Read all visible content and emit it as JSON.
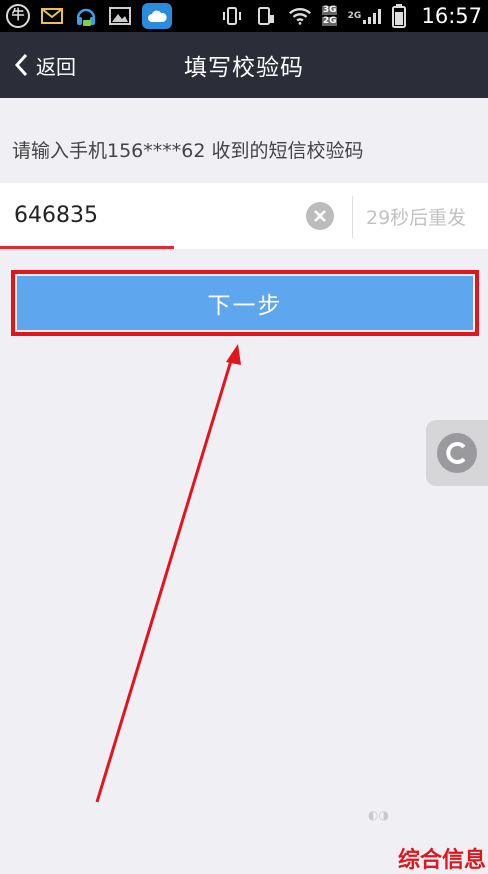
{
  "status_bar": {
    "carrier_glyph": "牛",
    "network_tags": [
      "3G",
      "2G",
      "2G"
    ],
    "time": "16:57",
    "icons": [
      "mail-icon",
      "headset-icon",
      "image-icon",
      "cloud-icon",
      "vibrate-icon",
      "phone-icon",
      "wifi-icon",
      "signal-icon",
      "battery-icon"
    ]
  },
  "nav": {
    "back_label": "返回",
    "title": "填写校验码"
  },
  "prompt": {
    "text": "请输入手机156****62  收到的短信校验码"
  },
  "verification": {
    "code_value": "646835",
    "resend_label": "29秒后重发"
  },
  "actions": {
    "next_label": "下一步"
  },
  "annotation": {
    "color": "#e3141c"
  },
  "watermark": {
    "text": "综合信息"
  },
  "colors": {
    "nav_bg": "#2b2e38",
    "page_bg": "#efeff4",
    "button_bg": "#5ea7ef",
    "accent_red": "#e8262e"
  }
}
